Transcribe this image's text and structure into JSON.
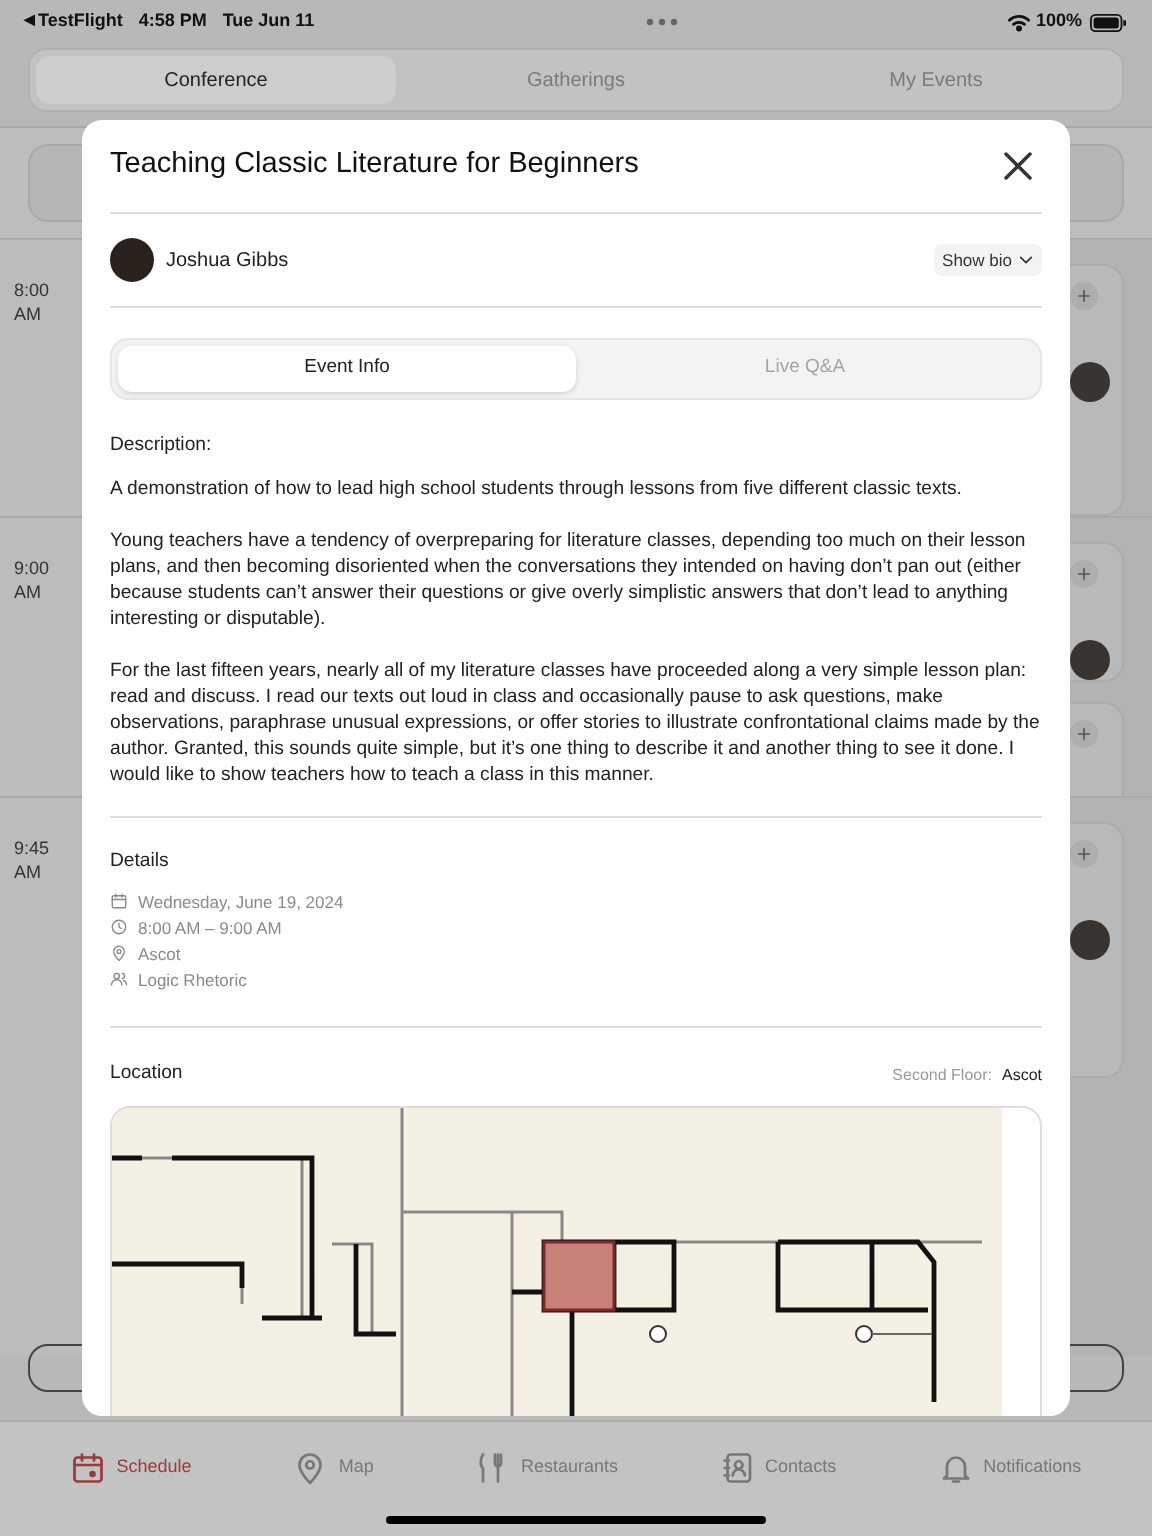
{
  "status_bar": {
    "back_glyph": "◀",
    "back_app": "TestFlight",
    "time": "4:58 PM",
    "date": "Tue Jun 11",
    "battery": "100%"
  },
  "segments": [
    {
      "label": "Conference",
      "selected": true
    },
    {
      "label": "Gatherings",
      "selected": false
    },
    {
      "label": "My Events",
      "selected": false
    }
  ],
  "schedule": [
    {
      "time": "8:00 AM"
    },
    {
      "time": "9:00 AM"
    },
    {
      "time": "9:45 AM"
    }
  ],
  "event_dialog": {
    "title": "Teaching Classic Literature for Beginners",
    "speaker": {
      "name": "Joshua Gibbs"
    },
    "show_bio": "Show bio",
    "tabs": [
      {
        "label": "Event Info",
        "selected": true
      },
      {
        "label": "Live Q&A",
        "selected": false
      }
    ],
    "description_label": "Description:",
    "description": [
      "A demonstration of how to lead high school students through lessons from five different classic texts.",
      "Young teachers have a tendency of overpreparing for literature classes, depending too much on their lesson plans, and then becoming disoriented when the conversations they intended on having don’t pan out (either because students can’t answer their questions or give overly simplistic answers that don’t lead to anything interesting or disputable).",
      "For the last fifteen years, nearly all of my literature classes have proceeded along a very simple lesson plan: read and discuss. I read our texts out loud in class and occasionally pause to ask questions, make observations, paraphrase unusual expressions, or offer stories to illustrate confrontational claims made by the author. Granted, this sounds quite simple, but it’s one thing to describe it and another thing to see it done. I would like to show teachers how to teach a class in this manner."
    ],
    "details_heading": "Details",
    "details": [
      {
        "kind": "date",
        "text": "Wednesday, June 19, 2024"
      },
      {
        "kind": "time",
        "text": "8:00 AM – 9:00 AM"
      },
      {
        "kind": "place",
        "text": "Ascot"
      },
      {
        "kind": "audience",
        "text": "Logic Rhetoric"
      }
    ],
    "location_heading": "Location",
    "floor_label": "Second Floor:",
    "room": "Ascot"
  },
  "tab_bar": [
    {
      "kind": "schedule",
      "label": "Schedule",
      "selected": true
    },
    {
      "kind": "map",
      "label": "Map",
      "selected": false
    },
    {
      "kind": "restaurants",
      "label": "Restaurants",
      "selected": false
    },
    {
      "kind": "contacts",
      "label": "Contacts",
      "selected": false
    },
    {
      "kind": "notifications",
      "label": "Notifications",
      "selected": false
    }
  ]
}
